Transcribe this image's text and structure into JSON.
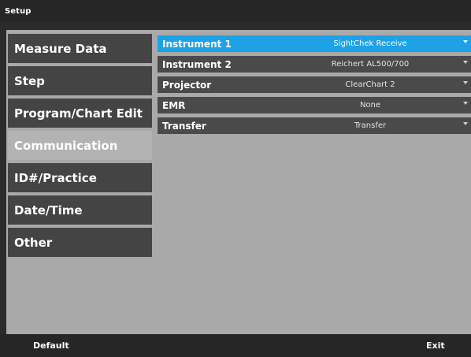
{
  "window": {
    "title": "Setup"
  },
  "sidebar": {
    "items": [
      {
        "label": "Measure Data",
        "active": false
      },
      {
        "label": "Step",
        "active": false
      },
      {
        "label": "Program/Chart Edit",
        "active": false
      },
      {
        "label": "Communication",
        "active": true
      },
      {
        "label": "ID#/Practice",
        "active": false
      },
      {
        "label": "Date/Time",
        "active": false
      },
      {
        "label": "Other",
        "active": false
      }
    ]
  },
  "settings": {
    "rows": [
      {
        "label": "Instrument 1",
        "value": "SightChek Receive",
        "selected": true
      },
      {
        "label": "Instrument 2",
        "value": "Reichert AL500/700",
        "selected": false
      },
      {
        "label": "Projector",
        "value": "ClearChart 2",
        "selected": false
      },
      {
        "label": "EMR",
        "value": "None",
        "selected": false
      },
      {
        "label": "Transfer",
        "value": "Transfer",
        "selected": false
      }
    ],
    "dropdown_icon": "chevron-down-icon"
  },
  "footer": {
    "default_label": "Default",
    "exit_label": "Exit"
  },
  "colors": {
    "selected_row": "#1ea1e6",
    "panel_bg": "#a9a9a9",
    "nav_bg": "#444444",
    "nav_active_bg": "#b3b3b3",
    "row_bg": "#4a4a4a"
  }
}
